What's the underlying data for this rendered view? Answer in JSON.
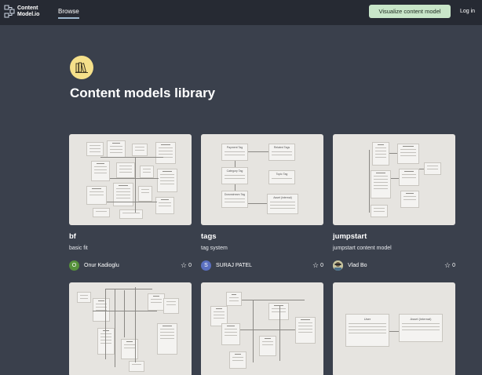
{
  "nav": {
    "logo_line1": "Content",
    "logo_line2": "Model.io",
    "browse_label": "Browse",
    "cta_label": "Visualize content model",
    "login_label": "Log in"
  },
  "hero": {
    "icon": "books-icon",
    "title": "Content models library"
  },
  "colors": {
    "nav_bg": "#262a33",
    "page_bg": "#3a404c",
    "cta_bg": "#c8e6c9",
    "hero_icon_bg": "#f5e08a",
    "avatar_green": "#56913b",
    "avatar_blue": "#5a6fc0"
  },
  "cards": [
    {
      "title": "bf",
      "description": "basic fit",
      "author": "Onur Kadioglu",
      "avatar_letter": "O",
      "stars": "0"
    },
    {
      "title": "tags",
      "description": "tag system",
      "author": "SURAJ PATEL",
      "avatar_letter": "S",
      "stars": "0"
    },
    {
      "title": "jumpstart",
      "description": "jumpstart content model",
      "author": "Vlad Bo",
      "avatar_letter": "",
      "stars": "0"
    }
  ],
  "diagrams": {
    "tags": [
      "Payment Tag",
      "Related Tags",
      "Category Tag",
      "Topic Tag",
      "Downstream Tag",
      "Asset (internal)"
    ],
    "row2_third": [
      "User",
      "Asset (internal)"
    ]
  }
}
